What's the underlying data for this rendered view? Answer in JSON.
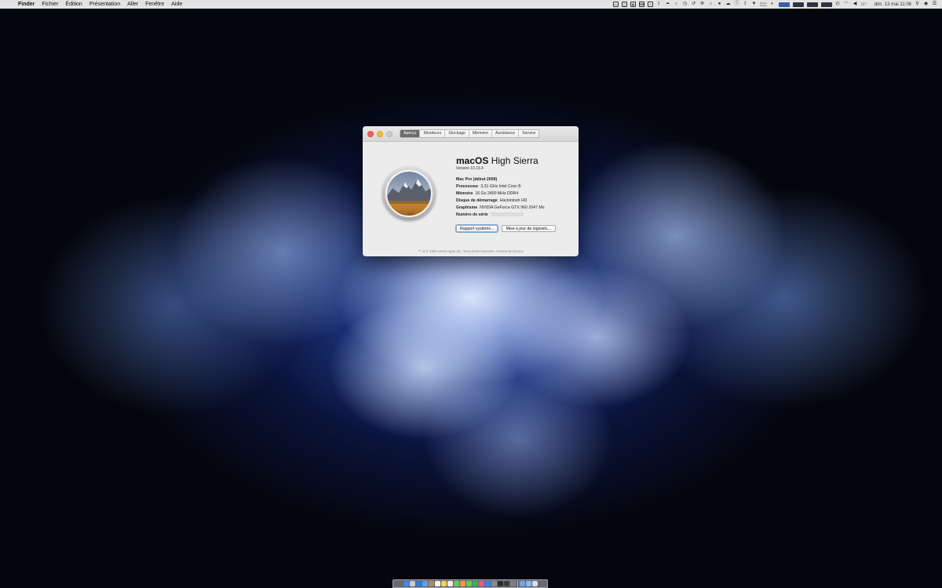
{
  "menubar": {
    "apple_glyph": "",
    "app_name": "Finder",
    "menus": [
      "Fichier",
      "Édition",
      "Présentation",
      "Aller",
      "Fenêtre",
      "Aide"
    ],
    "status_icons": [
      "display-icon",
      "screen-icon",
      "grid-icon",
      "keyboard-icon",
      "box-icon",
      "bluetooth-icon",
      "airplay-icon",
      "headphones-icon",
      "backup-icon",
      "time-machine-icon",
      "puzzle-icon",
      "audio-icon",
      "drop-icon",
      "cloud-icon",
      "info-icon",
      "upload-icon",
      "cast-icon"
    ],
    "stack_labels": [
      "0 Ko/s",
      "0 Ko/s"
    ],
    "temperature": "11°",
    "datetime": "dim. 13 mai 11:06"
  },
  "window": {
    "tabs": [
      "Aperçu",
      "Moniteurs",
      "Stockage",
      "Mémoire",
      "Assistance",
      "Service"
    ],
    "active_tab": "Aperçu",
    "os_name_bold": "macOS",
    "os_name_rest": " High Sierra",
    "os_version": "Version 10.13.4",
    "specs": [
      {
        "key": "Mac Pro (début 2008)",
        "value": ""
      },
      {
        "key": "Processeur",
        "value": "3,31 GHz Intel Core i5"
      },
      {
        "key": "Mémoire",
        "value": "16 Go 2400 MHz DDR4"
      },
      {
        "key": "Disque de démarrage",
        "value": "Hackintosh HD"
      },
      {
        "key": "Graphisme",
        "value": "NVIDIA GeForce GTX 960 2047 Mo"
      },
      {
        "key": "Numéro de série",
        "value": ""
      }
    ],
    "buttons": {
      "report": "Rapport système…",
      "update": "Mise à jour de logiciels…"
    },
    "footer_text": "™ et © 1983-2018 Apple Inc. Tous droits réservés.",
    "footer_link": "Contrat de licence"
  },
  "dock": {
    "apps": [
      {
        "name": "finder-icon",
        "color": "#3c8ddc"
      },
      {
        "name": "launchpad-icon",
        "color": "#c9ccd3"
      },
      {
        "name": "safari-icon",
        "color": "#2f7be0"
      },
      {
        "name": "mail-icon",
        "color": "#5aa4e8"
      },
      {
        "name": "contacts-icon",
        "color": "#b08a5a"
      },
      {
        "name": "calendar-icon",
        "color": "#f2f2f2"
      },
      {
        "name": "notes-icon",
        "color": "#f4d24a"
      },
      {
        "name": "reminders-icon",
        "color": "#eeeeee"
      },
      {
        "name": "maps-icon",
        "color": "#6cc36b"
      },
      {
        "name": "photos-icon",
        "color": "#e9a03c"
      },
      {
        "name": "messages-icon",
        "color": "#5fcf5a"
      },
      {
        "name": "facetime-icon",
        "color": "#3fb24a"
      },
      {
        "name": "itunes-icon",
        "color": "#e85a8c"
      },
      {
        "name": "appstore-icon",
        "color": "#2c8cf0"
      },
      {
        "name": "preferences-icon",
        "color": "#8a8a8e"
      },
      {
        "name": "terminal-icon",
        "color": "#2b2b2b"
      },
      {
        "name": "activity-icon",
        "color": "#3b3b3b"
      },
      {
        "name": "utility-icon",
        "color": "#7a7f88"
      }
    ],
    "trailing": [
      {
        "name": "downloads-folder-icon",
        "color": "#6aa6e8"
      },
      {
        "name": "documents-folder-icon",
        "color": "#8ab8ee"
      },
      {
        "name": "trash-icon",
        "color": "#d8dbe0"
      }
    ]
  }
}
